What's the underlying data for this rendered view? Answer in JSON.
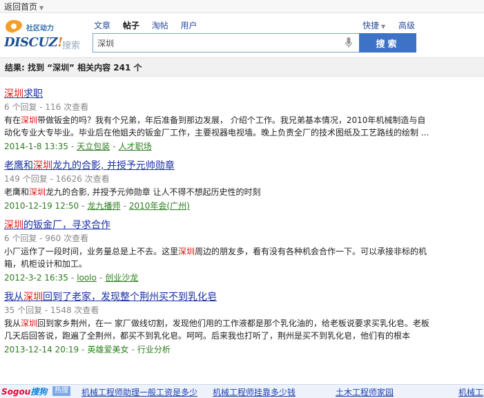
{
  "topbar": {
    "back_label": "返回首页"
  },
  "header": {
    "logo": {
      "community": "社区动力",
      "brand": "DISCUZ",
      "brand_bang": "!",
      "search_word": "搜索"
    },
    "tabs": [
      "文章",
      "帖子",
      "淘帖",
      "用户"
    ],
    "active_tab": "帖子",
    "quick_label": "快捷",
    "advanced_label": "高级",
    "search_value": "深圳",
    "search_button": "搜索"
  },
  "result_summary": "结果: 找到 “深圳” 相关内容 241 个",
  "results": [
    {
      "title_pre": "",
      "title_hl": "深圳",
      "title_post": "求职",
      "stats": "6 个回复 - 116 次查看",
      "snippet_pre": "有在",
      "snippet_hl": "深圳",
      "snippet_post": "带做钣金的吗？我有个兄弟，年后准备到那边发展， 介绍个工作。我兄弟基本情况，2010年机械制造与自动化专业大专毕业。毕业后在他姐夫的钣金厂工作，主要视器电视墙。晚上负责全厂的技术图纸及工艺路线的绘制 ...",
      "date": "2014-1-8 13:35",
      "author": "天立包装",
      "forum": "人才职场"
    },
    {
      "title_pre": "老鹰和",
      "title_hl": "深圳",
      "title_post": "龙九的合影, 并授予元帅勋章",
      "stats": "149 个回复 - 16626 次查看",
      "snippet_pre": "老鹰和",
      "snippet_hl": "深圳",
      "snippet_post": "龙九的合影, 并授予元帅勋章 让人不得不想起历史性的时刻",
      "date": "2010-12-19 12:50",
      "author": "龙九播师",
      "forum": "2010年会(广州)"
    },
    {
      "title_pre": "",
      "title_hl": "深圳",
      "title_post": "的钣金厂，寻求合作",
      "stats": "6 个回复 - 960 次查看",
      "snippet_pre": "小厂运作了一段时间，业务量总是上不去。这里",
      "snippet_hl": "深圳",
      "snippet_post": "周边的朋友多，看有没有各种机会合作一下。可以承接非标的机箱，机柜设计和加工。",
      "date": "2012-3-2 16:35",
      "author": "loolo",
      "forum": "创业沙龙"
    },
    {
      "title_pre": "我从",
      "title_hl": "深圳",
      "title_post": "回到了老家，发现整个荆州买不到乳化皂",
      "stats": "35 个回复 - 1548 次查看",
      "snippet_pre": "我从",
      "snippet_hl": "深圳",
      "snippet_post": "回到家乡荆州，在一 家厂做线切割，发现他们用的工作液都是那个乳化油的，给老板说要求买乳化皂。老板几天后回答说，跑遍了全荆州，都买不到乳化皂。呵呵。后来我也打听了，荆州是买不到乳化皂，他们有的根本",
      "date": "2013-12-14 20:19",
      "author": "英雄爱美女",
      "forum": "行业分析"
    }
  ],
  "sogou_bar": {
    "logo_main": "Sogou",
    "logo_suffix": "搜狗",
    "hot_label": "热搜",
    "links": [
      "机械工程师助理一般工资是多少",
      "机械工程师挂靠多少钱",
      "土木工程师家园",
      "机械工"
    ]
  }
}
